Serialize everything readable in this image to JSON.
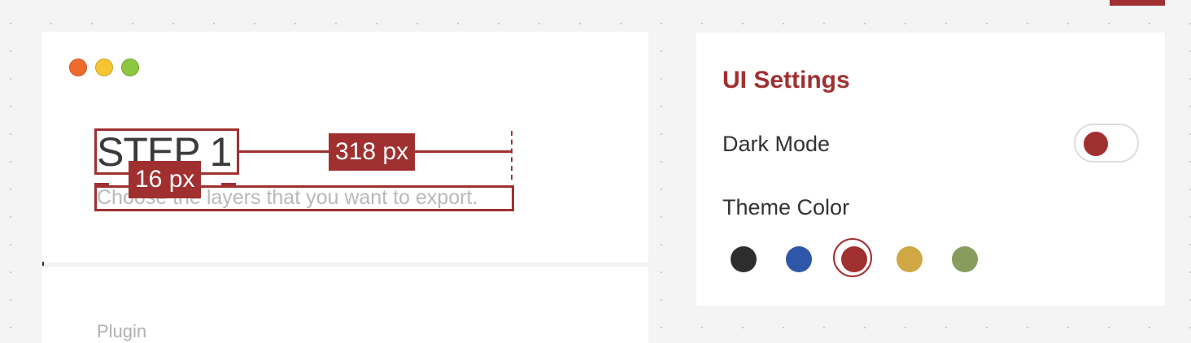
{
  "preview": {
    "step_title": "STEP 1",
    "subtitle": "Choose the layers that you want to export.",
    "measure_width_label": "318 px",
    "measure_gap_label": "16 px",
    "section_label": "Plugin"
  },
  "settings": {
    "title": "UI Settings",
    "dark_mode_label": "Dark Mode",
    "dark_mode_on": false,
    "theme_color_label": "Theme Color",
    "theme_colors": [
      "#2d2d2d",
      "#2f57a8",
      "#a03030",
      "#cfa845",
      "#889c5e"
    ],
    "selected_color": "#a03030"
  },
  "window_controls": {
    "close_color": "#ee6b2e",
    "minimize_color": "#f6c532",
    "maximize_color": "#8dc63f"
  }
}
